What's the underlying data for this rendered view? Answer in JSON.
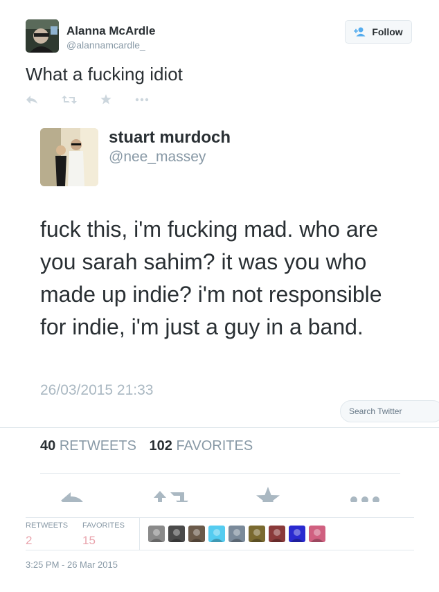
{
  "tweet": {
    "author_name": "Alanna McArdle",
    "author_handle": "@alannamcardle_",
    "follow_label": "Follow",
    "text": "What a fucking idiot",
    "timestamp": "3:25 PM - 26 Mar 2015",
    "actions": [
      "reply-icon",
      "retweet-icon",
      "favorite-icon",
      "more-icon"
    ]
  },
  "quoted": {
    "name": "stuart murdoch",
    "handle": "@nee_massey",
    "text": "fuck this, i'm fucking mad. who are you sarah sahim? it was you who made up indie? i'm not responsible for indie, i'm just a guy in a band.",
    "date": "26/03/2015 21:33",
    "retweets_count": "40",
    "retweets_label": "RETWEETS",
    "favorites_count": "102",
    "favorites_label": "FAVORITES"
  },
  "search": {
    "placeholder": "Search Twitter"
  },
  "stats": {
    "retweets_label": "RETWEETS",
    "retweets_value": "2",
    "favorites_label": "FAVORITES",
    "favorites_value": "15"
  },
  "favoriters": [
    {
      "icon": "favoriter-avatar",
      "color": "#8a8a8a"
    },
    {
      "icon": "favoriter-avatar",
      "color": "#4a4a4a"
    },
    {
      "icon": "favoriter-avatar",
      "color": "#6b5a4a"
    },
    {
      "icon": "favoriter-avatar",
      "color": "#55ccf0"
    },
    {
      "icon": "favoriter-avatar",
      "color": "#7a8a9a"
    },
    {
      "icon": "favoriter-avatar",
      "color": "#7a6a30"
    },
    {
      "icon": "favoriter-avatar",
      "color": "#8a3a3a"
    },
    {
      "icon": "favoriter-avatar",
      "color": "#2a2ad0"
    },
    {
      "icon": "favoriter-avatar",
      "color": "#d06080"
    }
  ],
  "colors": {
    "link_blue": "#55acee",
    "muted": "#8899a6",
    "stat_pink": "#e9a4ad"
  }
}
